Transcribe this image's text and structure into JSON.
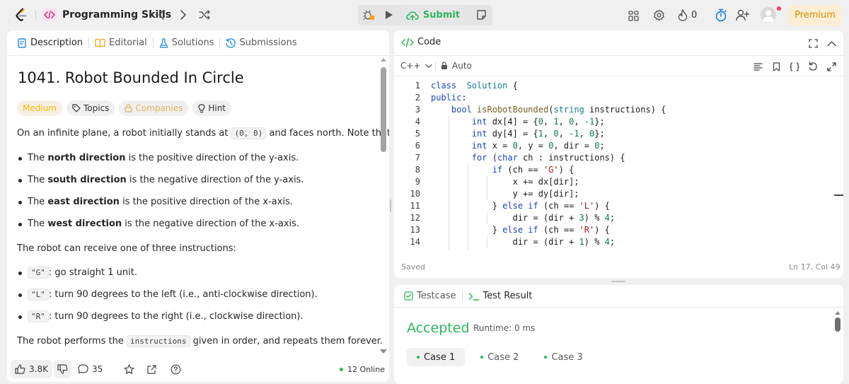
{
  "topbar": {
    "problem_list_title": "Programming Skills",
    "submit_label": "Submit",
    "streak_count": "0",
    "premium_label": "Premium"
  },
  "left_panel": {
    "tabs": [
      {
        "label": "Description"
      },
      {
        "label": "Editorial"
      },
      {
        "label": "Solutions"
      },
      {
        "label": "Submissions"
      }
    ],
    "title": "1041. Robot Bounded In Circle",
    "tags": {
      "difficulty": "Medium",
      "topics": "Topics",
      "companies": "Companies",
      "hint": "Hint"
    },
    "intro": {
      "before": "On an infinite plane, a robot initially stands at ",
      "code": "(0, 0)",
      "after": " and faces north. Note that:"
    },
    "directions": [
      {
        "pre": "The ",
        "bold": "north direction",
        "post": " is the positive direction of the y-axis."
      },
      {
        "pre": "The ",
        "bold": "south direction",
        "post": " is the negative direction of the y-axis."
      },
      {
        "pre": "The ",
        "bold": "east direction",
        "post": " is the positive direction of the x-axis."
      },
      {
        "pre": "The ",
        "bold": "west direction",
        "post": " is the negative direction of the x-axis."
      }
    ],
    "instructions_intro": "The robot can receive one of three instructions:",
    "instructions": [
      {
        "code": "\"G\"",
        "text": ": go straight 1 unit."
      },
      {
        "code": "\"L\"",
        "text": ": turn 90 degrees to the left (i.e., anti-clockwise direction)."
      },
      {
        "code": "\"R\"",
        "text": ": turn 90 degrees to the right (i.e., clockwise direction)."
      }
    ],
    "performs": {
      "before": "The robot performs the ",
      "code": "instructions",
      "after": " given in order, and repeats them forever."
    },
    "footer": {
      "likes": "3.8K",
      "comments": "35",
      "online": "12 Online"
    }
  },
  "editor": {
    "title": "Code",
    "language": "C++",
    "mode": "Auto",
    "status": "Saved",
    "cursor": "Ln 17, Col 49",
    "lines": [
      {
        "n": "1",
        "t": [
          [
            "kw",
            "class"
          ],
          [
            "",
            "  "
          ],
          [
            "ty",
            "Solution"
          ],
          [
            "",
            " {"
          ]
        ]
      },
      {
        "n": "2",
        "t": [
          [
            "kw",
            "public"
          ],
          [
            "",
            ":"
          ]
        ]
      },
      {
        "n": "3",
        "t": [
          [
            "",
            "    "
          ],
          [
            "kw",
            "bool"
          ],
          [
            "",
            " "
          ],
          [
            "fn",
            "isRobotBounded"
          ],
          [
            "",
            "("
          ],
          [
            "ty",
            "string"
          ],
          [
            "",
            " instructions) {"
          ]
        ]
      },
      {
        "n": "4",
        "t": [
          [
            "",
            "        "
          ],
          [
            "kw",
            "int"
          ],
          [
            "",
            " dx[4] = {"
          ],
          [
            "nu",
            "0"
          ],
          [
            "",
            ", "
          ],
          [
            "nu",
            "1"
          ],
          [
            "",
            ", "
          ],
          [
            "nu",
            "0"
          ],
          [
            "",
            ", "
          ],
          [
            "nu",
            "-1"
          ],
          [
            "",
            "};"
          ]
        ]
      },
      {
        "n": "5",
        "t": [
          [
            "",
            "        "
          ],
          [
            "kw",
            "int"
          ],
          [
            "",
            " dy[4] = {"
          ],
          [
            "nu",
            "1"
          ],
          [
            "",
            ", "
          ],
          [
            "nu",
            "0"
          ],
          [
            "",
            ", "
          ],
          [
            "nu",
            "-1"
          ],
          [
            "",
            ", "
          ],
          [
            "nu",
            "0"
          ],
          [
            "",
            "};"
          ]
        ]
      },
      {
        "n": "6",
        "t": [
          [
            "",
            "        "
          ],
          [
            "kw",
            "int"
          ],
          [
            "",
            " x = "
          ],
          [
            "nu",
            "0"
          ],
          [
            "",
            ", y = "
          ],
          [
            "nu",
            "0"
          ],
          [
            "",
            ", dir = "
          ],
          [
            "nu",
            "0"
          ],
          [
            "",
            ";"
          ]
        ]
      },
      {
        "n": "7",
        "t": [
          [
            "",
            "        "
          ],
          [
            "kw",
            "for"
          ],
          [
            "",
            " ("
          ],
          [
            "kw",
            "char"
          ],
          [
            "",
            " ch : instructions) {"
          ]
        ]
      },
      {
        "n": "8",
        "t": [
          [
            "",
            "            "
          ],
          [
            "kw",
            "if"
          ],
          [
            "",
            " (ch == "
          ],
          [
            "st",
            "'G'"
          ],
          [
            "",
            ") {"
          ]
        ]
      },
      {
        "n": "9",
        "t": [
          [
            "",
            "                x += dx[dir];"
          ]
        ]
      },
      {
        "n": "10",
        "t": [
          [
            "",
            "                y += dy[dir];"
          ]
        ]
      },
      {
        "n": "11",
        "t": [
          [
            "",
            "            } "
          ],
          [
            "kw",
            "else if"
          ],
          [
            "",
            " (ch == "
          ],
          [
            "st",
            "'L'"
          ],
          [
            "",
            ") {"
          ]
        ]
      },
      {
        "n": "12",
        "t": [
          [
            "",
            "                dir = (dir + "
          ],
          [
            "nu",
            "3"
          ],
          [
            "",
            ") % "
          ],
          [
            "nu",
            "4"
          ],
          [
            "",
            ";"
          ]
        ]
      },
      {
        "n": "13",
        "t": [
          [
            "",
            "            } "
          ],
          [
            "kw",
            "else if"
          ],
          [
            "",
            " (ch == "
          ],
          [
            "st",
            "'R'"
          ],
          [
            "",
            ") {"
          ]
        ]
      },
      {
        "n": "14",
        "t": [
          [
            "",
            "                dir = (dir + "
          ],
          [
            "nu",
            "1"
          ],
          [
            "",
            ") % "
          ],
          [
            "nu",
            "4"
          ],
          [
            "",
            ";"
          ]
        ]
      }
    ]
  },
  "bottom_panel": {
    "tabs": [
      {
        "label": "Testcase"
      },
      {
        "label": "Test Result"
      }
    ],
    "result": "Accepted",
    "runtime": "Runtime: 0 ms",
    "cases": [
      {
        "label": "Case 1"
      },
      {
        "label": "Case 2"
      },
      {
        "label": "Case 3"
      }
    ]
  },
  "colors": {
    "accepted": "#2db55d",
    "medium": "#ffb800",
    "premium_bg": "#fbeed5",
    "premium_text": "#d68d00"
  }
}
